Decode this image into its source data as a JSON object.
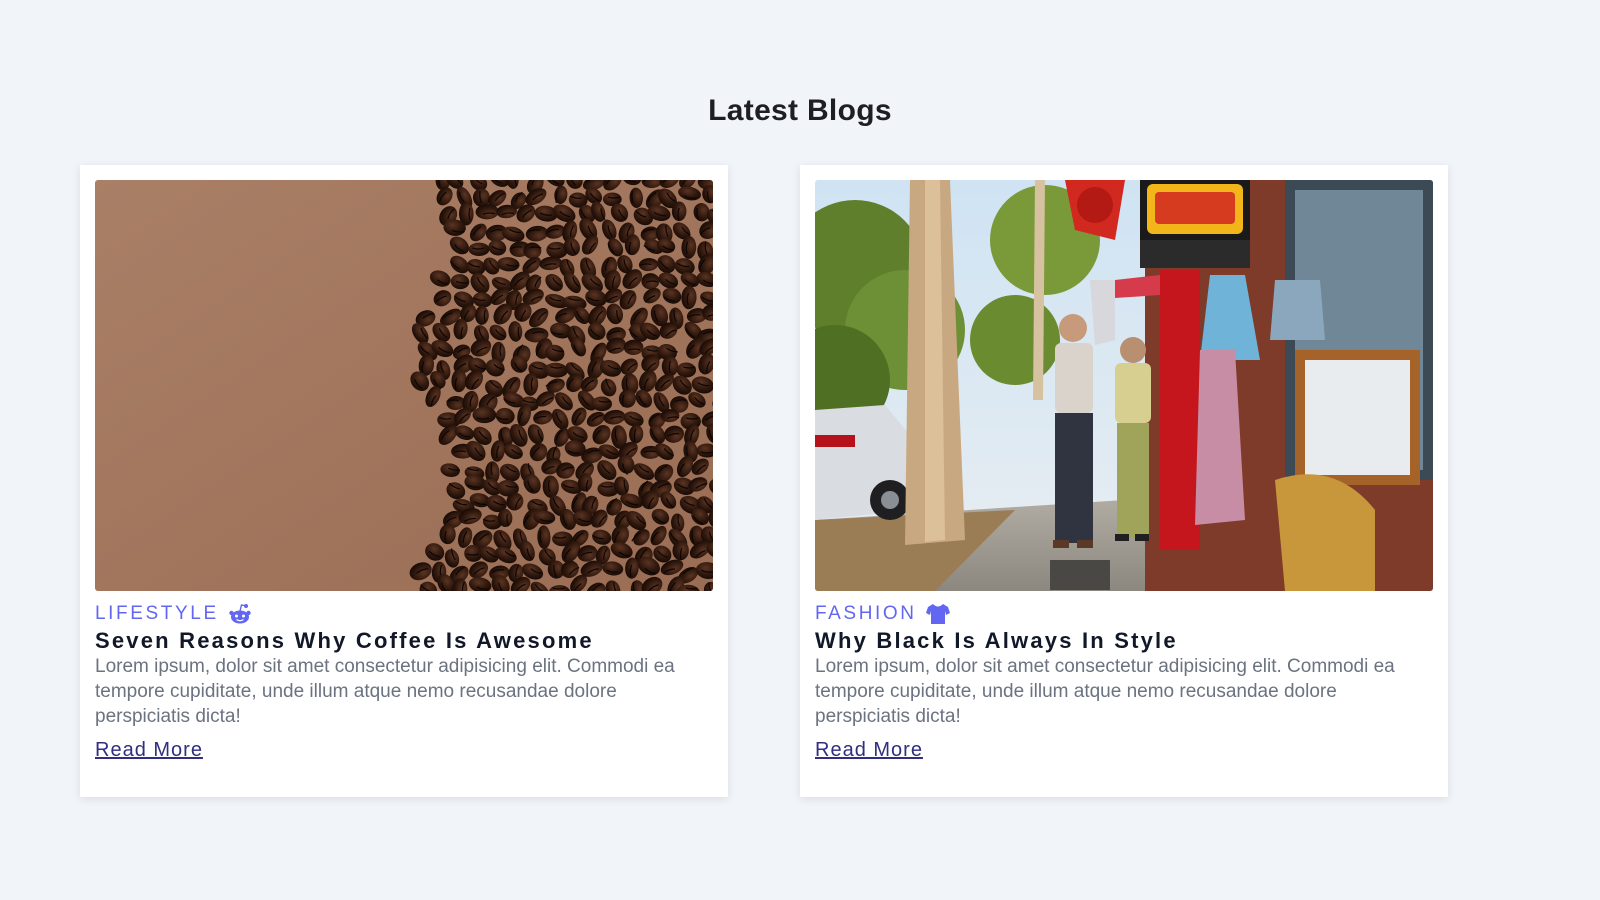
{
  "section": {
    "title": "Latest Blogs"
  },
  "accent_color": "#6366f1",
  "link_color": "#312e81",
  "posts": [
    {
      "category": "LIFESTYLE",
      "category_icon": "reddit-alien-icon",
      "title": "Seven Reasons Why Coffee Is Awesome",
      "excerpt": "Lorem ipsum, dolor sit amet consectetur adipisicing elit. Commodi ea tempore cupiditate, unde illum atque nemo recusandae dolore perspiciatis dicta!",
      "read_more": "Read More",
      "image": "coffee-beans-photo"
    },
    {
      "category": "FASHION",
      "category_icon": "tshirt-icon",
      "title": "Why Black Is Always In Style",
      "excerpt": "Lorem ipsum, dolor sit amet consectetur adipisicing elit. Commodi ea tempore cupiditate, unde illum atque nemo recusandae dolore perspiciatis dicta!",
      "read_more": "Read More",
      "image": "street-couple-photo"
    }
  ]
}
